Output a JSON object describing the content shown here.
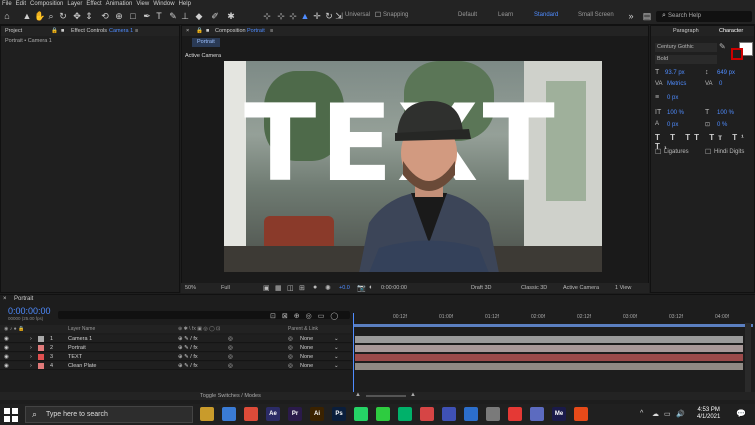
{
  "menu": [
    "File",
    "Edit",
    "Composition",
    "Layer",
    "Effect",
    "Animation",
    "View",
    "Window",
    "Help"
  ],
  "toolbar": {
    "universal_label": "Universal",
    "snapping_label": "Snapping",
    "workspaces": [
      "Default",
      "Learn",
      "Standard",
      "Small Screen"
    ],
    "active_workspace": "Standard",
    "search_placeholder": "Search Help"
  },
  "left_panel": {
    "tabs": [
      "Project",
      "Effect Controls"
    ],
    "effect_controls_target": "Camera 1",
    "crumb": "Portrait • Camera 1"
  },
  "comp_panel": {
    "tab": "Composition",
    "comp_name": "Portrait",
    "sub_tab": "Portrait",
    "view_label": "Active Camera",
    "content_text": "TEXT",
    "footer": {
      "zoom": "50%",
      "resolution": "Full",
      "exposure": "+0.0",
      "timecode": "0:00:00:00",
      "draft": "Draft 3D",
      "renderer": "Classic 3D",
      "camera": "Active Camera",
      "views": "1 View"
    }
  },
  "char_panel": {
    "tabs": [
      "Paragraph",
      "Character"
    ],
    "font": "Century Gothic",
    "style": "Bold",
    "size": "93.7 px",
    "leading": "649 px",
    "tracking": "Metrics",
    "kerning": "0",
    "scale_v": "100 %",
    "scale_h": "100 %",
    "baseline": "0 px",
    "tsume": "0 %",
    "ligatures": "Ligatures",
    "hindi": "Hindi Digits"
  },
  "timeline": {
    "tab": "Portrait",
    "timecode": "0:00:00:00",
    "frame_info": "00000 (25.00 fps)",
    "ticks": [
      "00:12f",
      "01:00f",
      "01:12f",
      "02:00f",
      "02:12f",
      "03:00f",
      "03:12f",
      "04:00f"
    ],
    "col_layer_name": "Layer Name",
    "col_parent": "Parent & Link",
    "layers": [
      {
        "num": "1",
        "name": "Camera 1",
        "parent": "None",
        "color": "#a9a9a9",
        "bar": "#9a9a9a"
      },
      {
        "num": "2",
        "name": "Portrait",
        "parent": "None",
        "color": "#e07a7a",
        "bar": "#a89898"
      },
      {
        "num": "3",
        "name": "TEXT",
        "parent": "None",
        "color": "#e05050",
        "bar": "#9b4a4a"
      },
      {
        "num": "4",
        "name": "Clean Plate",
        "parent": "None",
        "color": "#e07a7a",
        "bar": "#8f8a84"
      }
    ],
    "footer_label": "Toggle Switches / Modes"
  },
  "taskbar": {
    "search_placeholder": "Type here to search",
    "apps": [
      {
        "label": "",
        "color": "#c99b2b"
      },
      {
        "label": "",
        "color": "#3a7bd5"
      },
      {
        "label": "",
        "color": "#dd4b39"
      },
      {
        "label": "Ae",
        "color": "#2b2b66"
      },
      {
        "label": "Pr",
        "color": "#2a1a4a"
      },
      {
        "label": "Ai",
        "color": "#3a2200"
      },
      {
        "label": "Ps",
        "color": "#0a1e3c"
      },
      {
        "label": "",
        "color": "#25d366"
      },
      {
        "label": "",
        "color": "#2ecc40"
      },
      {
        "label": "",
        "color": "#00b16a"
      },
      {
        "label": "",
        "color": "#d64545"
      },
      {
        "label": "",
        "color": "#3f51b5"
      },
      {
        "label": "",
        "color": "#2c6ecb"
      },
      {
        "label": "",
        "color": "#7a7a7a"
      },
      {
        "label": "",
        "color": "#e53935"
      },
      {
        "label": "",
        "color": "#5c6bc0"
      },
      {
        "label": "Me",
        "color": "#1a1a4a"
      },
      {
        "label": "",
        "color": "#e64a19"
      }
    ],
    "time": "4:53 PM",
    "date": "4/1/2021"
  },
  "colors": {
    "accent": "#4f8cff"
  }
}
